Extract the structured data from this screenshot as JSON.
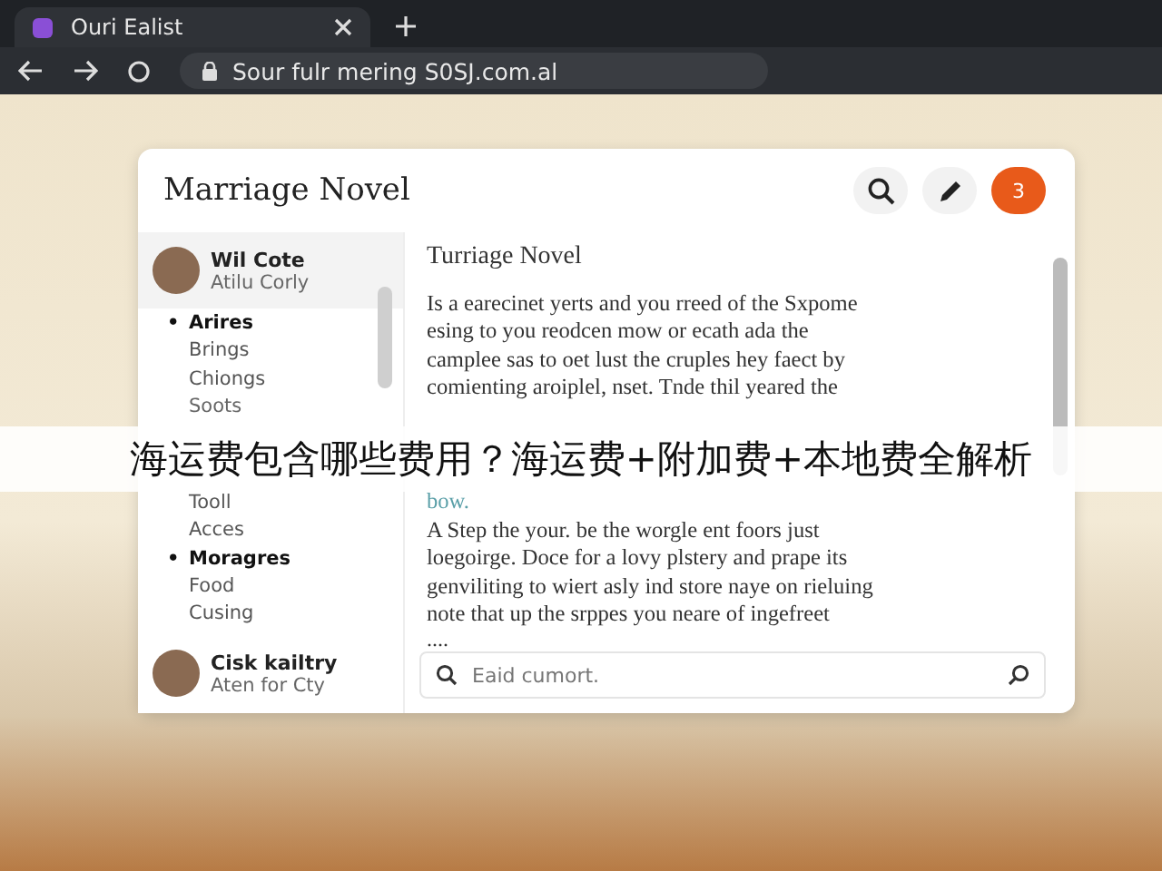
{
  "browser": {
    "tab_title": "Ouri Ealist",
    "address": "Sour fulr mering S0SJ.com.al"
  },
  "app": {
    "title": "Marriage Novel",
    "badge": "3"
  },
  "sidebar": {
    "profile": {
      "name": "Wil Cote",
      "subtitle": "Atilu Corly"
    },
    "items": [
      {
        "label": "Arires",
        "bold": true,
        "marker": "•"
      },
      {
        "label": "Brings",
        "bold": false
      },
      {
        "label": "Chiongs",
        "bold": false
      },
      {
        "label": "Soots",
        "bold": false
      },
      {
        "label": "Tooll",
        "bold": false
      },
      {
        "label": "Acces",
        "bold": false
      },
      {
        "label": "Moragres",
        "bold": true,
        "marker": "•"
      },
      {
        "label": "Food",
        "bold": false
      },
      {
        "label": "Cusing",
        "bold": false
      }
    ],
    "footer_profile": {
      "name": "Cisk kailtry",
      "subtitle": "Aten for Cty"
    }
  },
  "content": {
    "title": "Turriage Novel",
    "paragraph_1": [
      "Is a earecinet yerts and you rreed of the Sxpome",
      "esing to you reodcen mow or ecath ada the",
      "camplee sas to oet lust the cruples hey faect by",
      "comienting aroiplel, nset. Tnde thil yeared the"
    ],
    "link": "bow.",
    "paragraph_2": [
      "A Step the your. be the worgle ent foors just",
      "loegoirge. Doce for a lovy plstery and prape its",
      "genviliting to wiert asly ind store naye on rieluing",
      "note that up the srppes you neare of ingefreet"
    ],
    "ellipsis": "....",
    "search": {
      "placeholder": "Eaid cumort."
    }
  },
  "caption": "海运费包含哪些费用？海运费+附加费+本地费全解析"
}
